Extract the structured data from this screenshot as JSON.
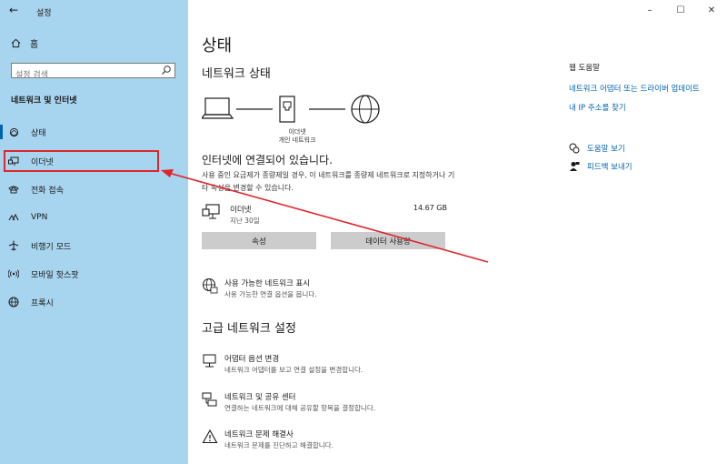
{
  "window": {
    "title": "설정",
    "minimize_glyph": "–",
    "maximize_glyph": "☐",
    "close_glyph": "✕",
    "back_glyph": "←"
  },
  "sidebar": {
    "home_label": "홈",
    "search_placeholder": "설정 검색",
    "section_heading": "네트워크 및 인터넷",
    "items": [
      {
        "label": "상태",
        "icon": "home-globe-icon"
      },
      {
        "label": "이더넷",
        "icon": "ethernet-monitor-icon"
      },
      {
        "label": "전화 접속",
        "icon": "dialup-phone-icon"
      },
      {
        "label": "VPN",
        "icon": "vpn-icon"
      },
      {
        "label": "비행기 모드",
        "icon": "airplane-icon"
      },
      {
        "label": "모바일 핫스팟",
        "icon": "hotspot-icon"
      },
      {
        "label": "프록시",
        "icon": "globe-icon"
      }
    ]
  },
  "main": {
    "page_title": "상태",
    "network_status_title": "네트워크 상태",
    "adapter_label": "이더넷",
    "network_type_label": "개인 네트워크",
    "connected_text": "인터넷에 연결되어 있습니다.",
    "description": "사용 중인 요금제가 종량제일 경우, 이 네트워크를 종량제 네트워크로 지정하거나 기타 속성을 변경할 수 있습니다.",
    "ethernet": {
      "name": "이더넷",
      "period": "지난 30일",
      "usage": "14.67 GB"
    },
    "properties_button": "속성",
    "data_usage_button": "데이터 사용량",
    "show_networks": {
      "title": "사용 가능한 네트워크 표시",
      "subtitle": "사용 가능한 연결 옵션을 봅니다."
    },
    "advanced_title": "고급 네트워크 설정",
    "advanced_items": [
      {
        "title": "어댑터 옵션 변경",
        "subtitle": "네트워크 어댑터를 보고 연결 설정을 변경합니다."
      },
      {
        "title": "네트워크 및 공유 센터",
        "subtitle": "연결하는 네트워크에 대해 공유할 항목을 결정합니다."
      },
      {
        "title": "네트워크 문제 해결사",
        "subtitle": "네트워크 문제를 진단하고 해결합니다."
      }
    ]
  },
  "right_panel": {
    "heading": "웹 도움말",
    "links": [
      "네트워크 어댑터 또는 드라이버 업데이트",
      "내 IP 주소를 찾기"
    ],
    "help_label": "도움말 보기",
    "feedback_label": "피드백 보내기"
  },
  "colors": {
    "sidebar_bg": "#a7d4ee",
    "accent": "#0063b1",
    "annotation": "#e0252b",
    "button_bg": "#cccccc"
  }
}
